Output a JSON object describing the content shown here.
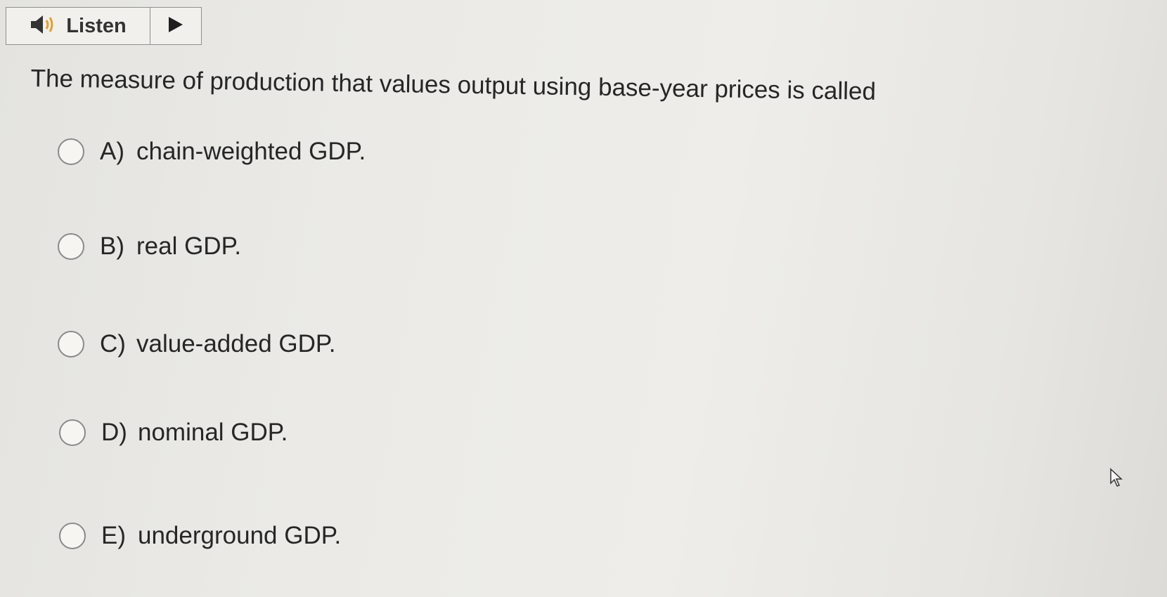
{
  "toolbar": {
    "listen_label": "Listen",
    "speaker_icon": "speaker-icon",
    "play_icon": "play-icon"
  },
  "question": {
    "text": "The measure of production that values output using base-year prices is called"
  },
  "options": [
    {
      "letter": "A)",
      "text": "chain-weighted GDP."
    },
    {
      "letter": "B)",
      "text": "real GDP."
    },
    {
      "letter": "C)",
      "text": "value-added GDP."
    },
    {
      "letter": "D)",
      "text": "nominal GDP."
    },
    {
      "letter": "E)",
      "text": "underground GDP."
    }
  ],
  "colors": {
    "text": "#262626",
    "radio_border": "#8a8a8a",
    "toolbar_border": "#8f8f8f"
  }
}
